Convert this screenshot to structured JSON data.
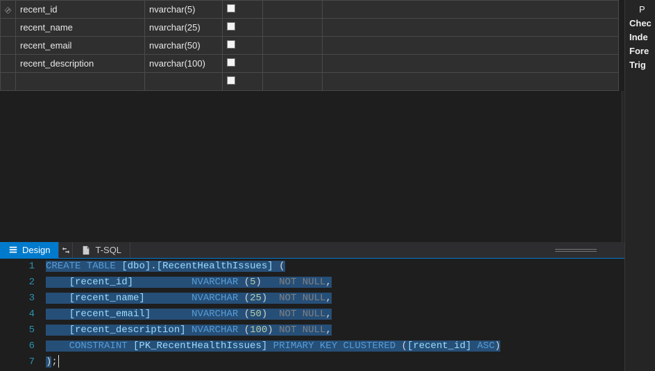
{
  "designer_grid": {
    "rows": [
      {
        "pk": true,
        "name": "recent_id",
        "datatype": "nvarchar(5)",
        "allow_nulls": false
      },
      {
        "pk": false,
        "name": "recent_name",
        "datatype": "nvarchar(25)",
        "allow_nulls": false
      },
      {
        "pk": false,
        "name": "recent_email",
        "datatype": "nvarchar(50)",
        "allow_nulls": false
      },
      {
        "pk": false,
        "name": "recent_description",
        "datatype": "nvarchar(100)",
        "allow_nulls": false
      }
    ]
  },
  "tabs": {
    "design": "Design",
    "tsql": "T-SQL",
    "active": "design"
  },
  "side_panel": {
    "items": [
      "P",
      "Chec",
      "Inde",
      "Fore",
      "Trig"
    ]
  },
  "sql": {
    "lines": [
      {
        "n": 1,
        "tokens": [
          {
            "c": "k",
            "t": "CREATE"
          },
          {
            "c": "p",
            "t": " "
          },
          {
            "c": "k",
            "t": "TABLE"
          },
          {
            "c": "p",
            "t": " "
          },
          {
            "c": "t",
            "t": "[dbo]"
          },
          {
            "c": "p",
            "t": "."
          },
          {
            "c": "t",
            "t": "[RecentHealthIssues]"
          },
          {
            "c": "p",
            "t": " ("
          }
        ]
      },
      {
        "n": 2,
        "tokens": [
          {
            "c": "p",
            "t": "    "
          },
          {
            "c": "t",
            "t": "[recent_id]"
          },
          {
            "c": "p",
            "t": "          "
          },
          {
            "c": "k",
            "t": "NVARCHAR"
          },
          {
            "c": "p",
            "t": " ("
          },
          {
            "c": "n",
            "t": "5"
          },
          {
            "c": "p",
            "t": ")   "
          },
          {
            "c": "g",
            "t": "NOT"
          },
          {
            "c": "p",
            "t": " "
          },
          {
            "c": "g",
            "t": "NULL"
          },
          {
            "c": "p",
            "t": ","
          }
        ]
      },
      {
        "n": 3,
        "tokens": [
          {
            "c": "p",
            "t": "    "
          },
          {
            "c": "t",
            "t": "[recent_name]"
          },
          {
            "c": "p",
            "t": "        "
          },
          {
            "c": "k",
            "t": "NVARCHAR"
          },
          {
            "c": "p",
            "t": " ("
          },
          {
            "c": "n",
            "t": "25"
          },
          {
            "c": "p",
            "t": ")  "
          },
          {
            "c": "g",
            "t": "NOT"
          },
          {
            "c": "p",
            "t": " "
          },
          {
            "c": "g",
            "t": "NULL"
          },
          {
            "c": "p",
            "t": ","
          }
        ]
      },
      {
        "n": 4,
        "tokens": [
          {
            "c": "p",
            "t": "    "
          },
          {
            "c": "t",
            "t": "[recent_email]"
          },
          {
            "c": "p",
            "t": "       "
          },
          {
            "c": "k",
            "t": "NVARCHAR"
          },
          {
            "c": "p",
            "t": " ("
          },
          {
            "c": "n",
            "t": "50"
          },
          {
            "c": "p",
            "t": ")  "
          },
          {
            "c": "g",
            "t": "NOT"
          },
          {
            "c": "p",
            "t": " "
          },
          {
            "c": "g",
            "t": "NULL"
          },
          {
            "c": "p",
            "t": ","
          }
        ]
      },
      {
        "n": 5,
        "tokens": [
          {
            "c": "p",
            "t": "    "
          },
          {
            "c": "t",
            "t": "[recent_description]"
          },
          {
            "c": "p",
            "t": " "
          },
          {
            "c": "k",
            "t": "NVARCHAR"
          },
          {
            "c": "p",
            "t": " ("
          },
          {
            "c": "n",
            "t": "100"
          },
          {
            "c": "p",
            "t": ") "
          },
          {
            "c": "g",
            "t": "NOT"
          },
          {
            "c": "p",
            "t": " "
          },
          {
            "c": "g",
            "t": "NULL"
          },
          {
            "c": "p",
            "t": ","
          }
        ]
      },
      {
        "n": 6,
        "tokens": [
          {
            "c": "p",
            "t": "    "
          },
          {
            "c": "k",
            "t": "CONSTRAINT"
          },
          {
            "c": "p",
            "t": " "
          },
          {
            "c": "t",
            "t": "[PK_RecentHealthIssues]"
          },
          {
            "c": "p",
            "t": " "
          },
          {
            "c": "k",
            "t": "PRIMARY"
          },
          {
            "c": "p",
            "t": " "
          },
          {
            "c": "k",
            "t": "KEY"
          },
          {
            "c": "p",
            "t": " "
          },
          {
            "c": "k",
            "t": "CLUSTERED"
          },
          {
            "c": "p",
            "t": " ("
          },
          {
            "c": "t",
            "t": "[recent_id]"
          },
          {
            "c": "p",
            "t": " "
          },
          {
            "c": "k",
            "t": "ASC"
          },
          {
            "c": "p",
            "t": ")"
          }
        ]
      },
      {
        "n": 7,
        "tokens": [
          {
            "c": "p",
            "t": ");"
          }
        ],
        "partial_selection": true
      }
    ]
  }
}
